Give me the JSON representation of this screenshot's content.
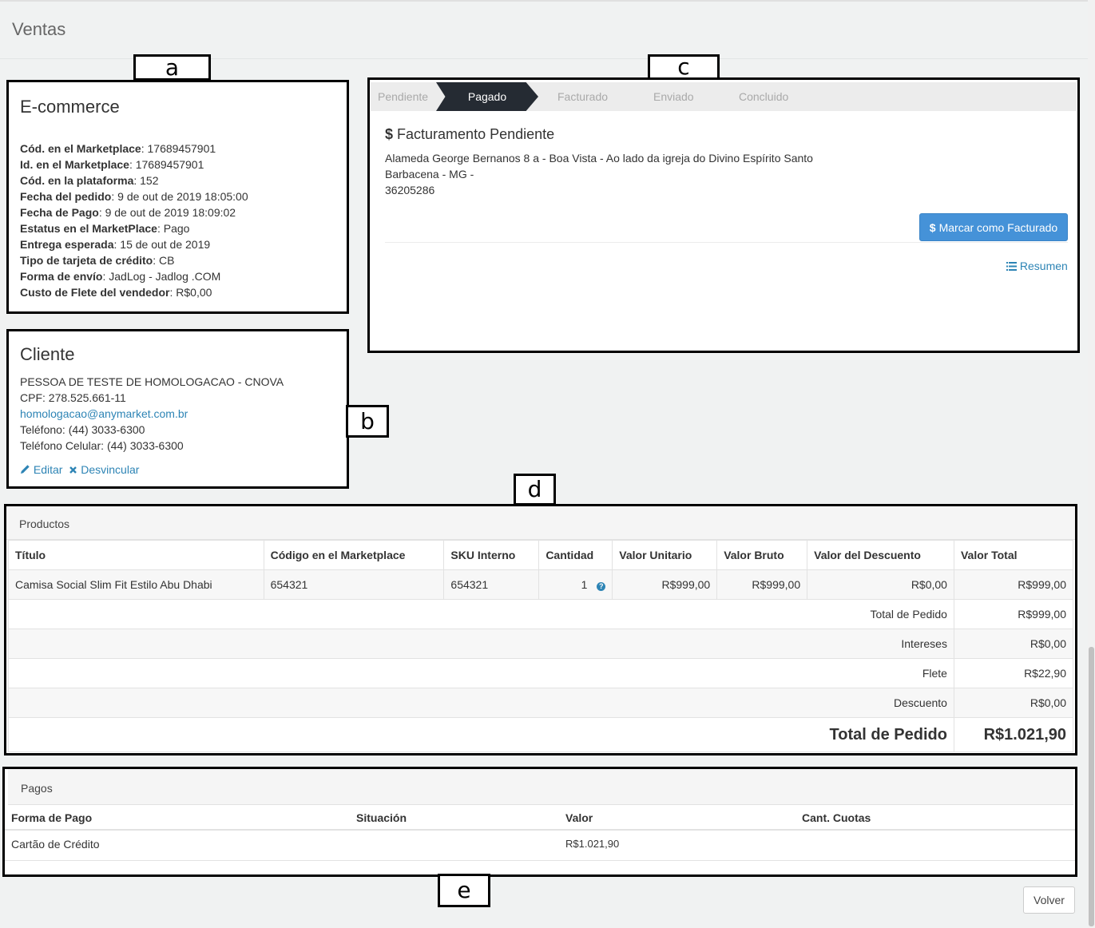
{
  "page": {
    "title": "Ventas"
  },
  "markers": {
    "a": "a",
    "b": "b",
    "c": "c",
    "d": "d",
    "e": "e"
  },
  "ecommerce": {
    "title": "E-commerce",
    "fields": [
      {
        "label": "Cód. en el Marketplace",
        "value": ": 17689457901"
      },
      {
        "label": "Id. en el Marketplace",
        "value": ": 17689457901"
      },
      {
        "label": "Cód. en la plataforma",
        "value": ": 152"
      },
      {
        "label": "Fecha del pedido",
        "value": ": 9 de out de 2019 18:05:00"
      },
      {
        "label": "Fecha de Pago",
        "value": ": 9 de out de 2019 18:09:02"
      },
      {
        "label": "Estatus en el MarketPlace",
        "value": ": Pago"
      },
      {
        "label": "Entrega esperada",
        "value": ": 15 de out de 2019"
      },
      {
        "label": "Tipo de tarjeta de crédito",
        "value": ": CB"
      },
      {
        "label": "Forma de envío",
        "value": ": JadLog - Jadlog .COM"
      },
      {
        "label": "Custo de Flete del vendedor",
        "value": ": R$0,00"
      }
    ]
  },
  "cliente": {
    "title": "Cliente",
    "name": "PESSOA DE TESTE DE HOMOLOGACAO - CNOVA",
    "cpf": "CPF: 278.525.661-11",
    "email": "homologacao@anymarket.com.br",
    "phone": "Teléfono: (44) 3033-6300",
    "mobile": "Teléfono Celular: (44) 3033-6300",
    "edit_label": "Editar",
    "unlink_label": "Desvincular"
  },
  "status": {
    "steps": [
      "Pendiente",
      "Pagado",
      "Facturado",
      "Enviado",
      "Concluido"
    ],
    "active": "Pagado",
    "heading": "Facturamento Pendiente",
    "address_line1": "Alameda George Bernanos 8 a - Boa Vista - Ao lado da igreja do Divino Espírito Santo",
    "address_line2": "Barbacena - MG -",
    "address_line3": "36205286",
    "button_label": "Marcar como Facturado",
    "summary_link": "Resumen"
  },
  "productos": {
    "title": "Productos",
    "columns": [
      "Título",
      "Código en el Marketplace",
      "SKU Interno",
      "Cantidad",
      "Valor Unitario",
      "Valor Bruto",
      "Valor del Descuento",
      "Valor Total"
    ],
    "rows": [
      {
        "titulo": "Camisa Social Slim Fit Estilo Abu Dhabi",
        "codigo": "654321",
        "sku": "654321",
        "cantidad": "1",
        "unitario": "R$999,00",
        "bruto": "R$999,00",
        "descuento": "R$0,00",
        "total": "R$999,00"
      }
    ],
    "totals": [
      {
        "label": "Total de Pedido",
        "value": "R$999,00"
      },
      {
        "label": "Intereses",
        "value": "R$0,00"
      },
      {
        "label": "Flete",
        "value": "R$22,90"
      },
      {
        "label": "Descuento",
        "value": "R$0,00"
      }
    ],
    "grand_total_label": "Total de Pedido",
    "grand_total_value": "R$1.021,90"
  },
  "pagos": {
    "title": "Pagos",
    "columns": [
      "Forma de Pago",
      "Situación",
      "Valor",
      "Cant. Cuotas"
    ],
    "rows": [
      {
        "forma": "Cartão de Crédito",
        "situacion": "",
        "valor": "R$1.021,90",
        "cuotas": ""
      }
    ]
  },
  "footer": {
    "back_label": "Volver"
  },
  "colors": {
    "accent": "#4592d8",
    "link": "#2d84b5",
    "wizard_active": "#252b33"
  }
}
